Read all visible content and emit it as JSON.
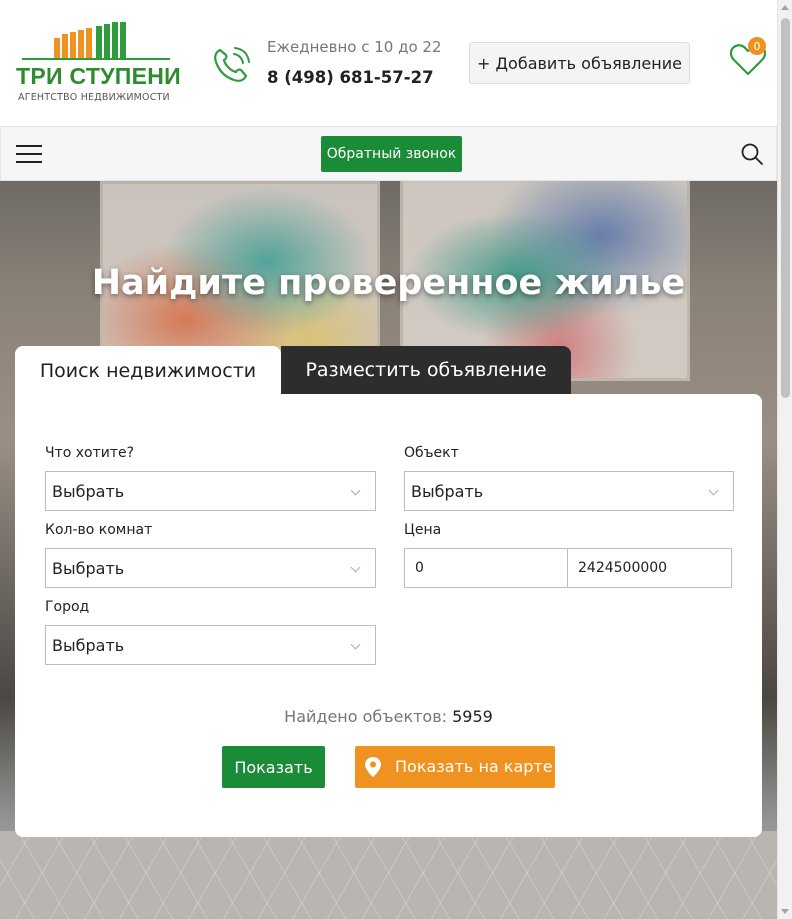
{
  "header": {
    "logo_title": "ТРИ СТУПЕНИ",
    "logo_subtitle": "АГЕНТСТВО НЕДВИЖИМОСТИ",
    "work_hours": "Ежедневно с 10 до 22",
    "phone": "8 (498) 681-57-27",
    "add_listing_label": "+ Добавить объявление",
    "favorites_count": "0"
  },
  "navbar": {
    "callback_label": "Обратный звонок"
  },
  "hero": {
    "title": "Найдите проверенное жилье"
  },
  "tabs": [
    {
      "label": "Поиск недвижимости",
      "active": true
    },
    {
      "label": "Разместить объявление",
      "active": false
    }
  ],
  "form": {
    "want_label": "Что хотите?",
    "want_value": "Выбрать",
    "object_label": "Объект",
    "object_value": "Выбрать",
    "rooms_label": "Кол-во комнат",
    "rooms_value": "Выбрать",
    "price_label": "Цена",
    "price_min": "0",
    "price_max": "2424500000",
    "city_label": "Город",
    "city_value": "Выбрать",
    "found_label": "Найдено объектов:",
    "found_count": "5959",
    "show_label": "Показать",
    "map_label": "Показать на карте"
  },
  "colors": {
    "brand_green": "#1a8b37",
    "accent_orange": "#f0921f",
    "tab_dark": "#2d2d2d"
  }
}
